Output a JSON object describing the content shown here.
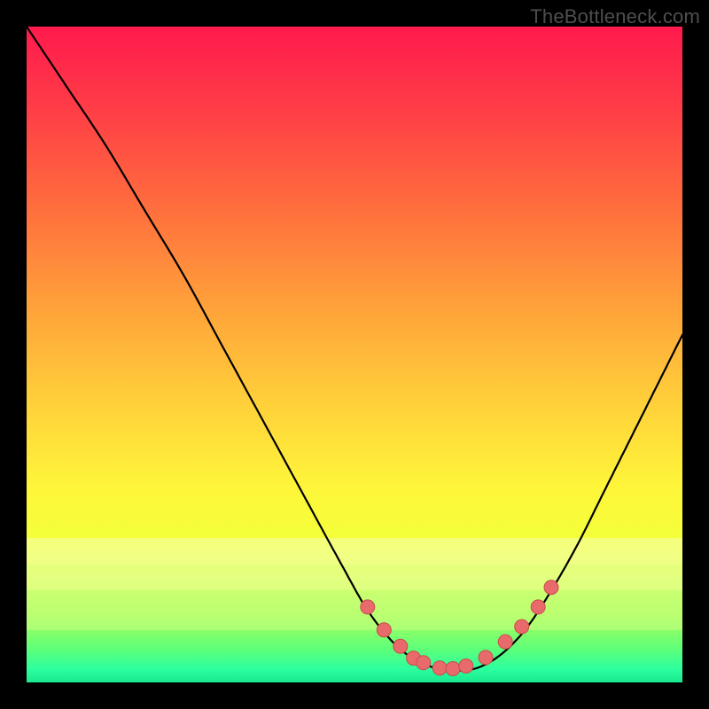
{
  "watermark": "TheBottleneck.com",
  "colors": {
    "page_bg": "#000000",
    "curve_stroke": "#000000",
    "marker_fill": "#e86a6a",
    "marker_stroke": "#c94c4c"
  },
  "chart_data": {
    "type": "line",
    "title": "",
    "xlabel": "",
    "ylabel": "",
    "xlim": [
      0,
      100
    ],
    "ylim": [
      0,
      100
    ],
    "grid": false,
    "legend": false,
    "note": "Axes unlabeled in source image; values are percentage positions within the plot area (0 = left/top, 100 = right/bottom).",
    "series": [
      {
        "name": "bottleneck-curve",
        "x": [
          0,
          6,
          12,
          18,
          24,
          30,
          36,
          42,
          48,
          52,
          56,
          60,
          64,
          68,
          72,
          76,
          80,
          84,
          88,
          92,
          96,
          100
        ],
        "y": [
          0,
          9,
          18,
          28,
          38,
          49,
          60,
          71,
          82,
          89,
          94,
          97,
          98,
          98,
          96,
          92,
          86,
          79,
          71,
          63,
          55,
          47
        ]
      }
    ],
    "markers": {
      "name": "highlight-dots",
      "x": [
        52.0,
        54.5,
        57.0,
        59.0,
        60.5,
        63.0,
        65.0,
        67.0,
        70.0,
        73.0,
        75.5,
        78.0,
        80.0
      ],
      "y": [
        88.5,
        92.0,
        94.5,
        96.3,
        97.0,
        97.8,
        97.9,
        97.5,
        96.2,
        93.8,
        91.5,
        88.5,
        85.5
      ]
    },
    "highlight_bands": [
      {
        "y_from": 78,
        "y_to": 82,
        "color": "#f8ffb0",
        "opacity": 0.55
      },
      {
        "y_from": 82,
        "y_to": 86,
        "color": "#eaff9a",
        "opacity": 0.55
      },
      {
        "y_from": 86,
        "y_to": 92,
        "color": "#c8ff84",
        "opacity": 0.5
      }
    ]
  }
}
